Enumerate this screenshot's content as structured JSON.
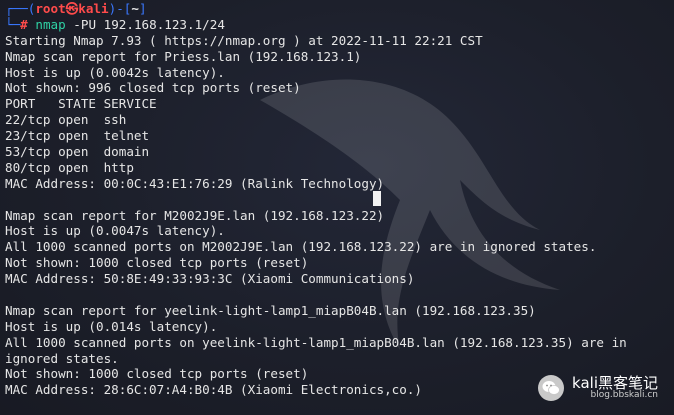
{
  "prompt": {
    "box_start": "┌──(",
    "user_host": "root㉿kali",
    "box_mid": ")-[",
    "path": "~",
    "box_end": "]",
    "second_prefix": "└─",
    "hash": "#",
    "cmd_name": "nmap",
    "cmd_args": " -PU 192.168.123.1/24"
  },
  "output": [
    "Starting Nmap 7.93 ( https://nmap.org ) at 2022-11-11 22:21 CST",
    "Nmap scan report for Priess.lan (192.168.123.1)",
    "Host is up (0.0042s latency).",
    "Not shown: 996 closed tcp ports (reset)",
    "PORT   STATE SERVICE",
    "22/tcp open  ssh",
    "23/tcp open  telnet",
    "53/tcp open  domain",
    "80/tcp open  http",
    "MAC Address: 00:0C:43:E1:76:29 (Ralink Technology)",
    "",
    "Nmap scan report for M2002J9E.lan (192.168.123.22)",
    "Host is up (0.0047s latency).",
    "All 1000 scanned ports on M2002J9E.lan (192.168.123.22) are in ignored states.",
    "Not shown: 1000 closed tcp ports (reset)",
    "MAC Address: 50:8E:49:33:93:3C (Xiaomi Communications)",
    "",
    "Nmap scan report for yeelink-light-lamp1_miapB04B.lan (192.168.123.35)",
    "Host is up (0.014s latency).",
    "All 1000 scanned ports on yeelink-light-lamp1_miapB04B.lan (192.168.123.35) are in",
    "ignored states.",
    "Not shown: 1000 closed tcp ports (reset)",
    "MAC Address: 28:6C:07:A4:B0:4B (Xiaomi Electronics,co.)"
  ],
  "watermark": {
    "title": "kali黑客笔记",
    "subtitle": "blog.bbskali.cn",
    "icon": "wechat-icon"
  },
  "colors": {
    "background": "#1c1f2a",
    "prompt_box": "#3a78ff",
    "prompt_user": "#ff4b4b",
    "command": "#2fd1a4",
    "text": "#e6e6e6"
  }
}
